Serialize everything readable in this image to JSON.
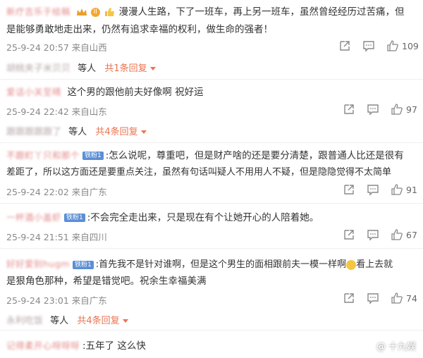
{
  "comments": [
    {
      "username": "新疗吉乐于绘稿",
      "line1": "漫漫人生路，下了一班车，再上另一班车，虽然曾经经历过苦痛，但",
      "line2": "是能够勇敢地走出来，仍然有追求幸福的权利，做生命的强者！",
      "badge": "II",
      "time": "25-9-24 20:57",
      "location": "来自山西",
      "likes": "109"
    },
    {
      "username": "爱话小关至晴",
      "line1": "这个男的跟他前夫好像啊  祝好运",
      "time": "25-9-24 22:42",
      "location": "来自山东",
      "likes": "97"
    },
    {
      "username": "不跟町丫只和那个",
      "badge": "铁粉1",
      "line1": ":怎么说呢，尊重吧，但是财产啥的还是要分清楚，跟普通人比还是很有",
      "line2": "差距了，所以这方面还是要重点关注，虽然有句话叫疑人不用用人不疑，但是隐隐觉得不太简单",
      "time": "25-9-24 22:02",
      "location": "来自广东",
      "likes": "91"
    },
    {
      "username": "一杯酒小盖虾",
      "badge": "铁粉1",
      "line1": ":不会完全走出来，只是现在有个让她开心的人陪着她。",
      "time": "25-9-24 21:51",
      "location": "来自四川",
      "likes": "67"
    },
    {
      "username": "好好爱别hugm",
      "badge": "铁粉1",
      "line1a": ":首先我不是针对谁啊，但是这个男生的面相跟前夫一模一样啊",
      "line1b": "看上去就",
      "line2": "是狠角色那种，希望是错觉吧。祝余生幸福美满",
      "time": "25-9-24 23:01",
      "location": "来自广东",
      "likes": "74"
    },
    {
      "username": "记得柔开心呀呀呀",
      "line1": ":五年了 这么快"
    }
  ],
  "replies": [
    {
      "names": "胡桃夹子米贝贝",
      "suffix": "等人",
      "count": "共1条回复"
    },
    {
      "names": "跟跟跟跟跟了",
      "suffix": "等人",
      "count": "共4条回复"
    },
    {
      "names": "永利吃饭",
      "suffix": "等人",
      "count": "共4条回复"
    }
  ],
  "watermark": "@ 十九娱",
  "icons": [
    "share-icon",
    "comment-icon",
    "like-icon"
  ]
}
